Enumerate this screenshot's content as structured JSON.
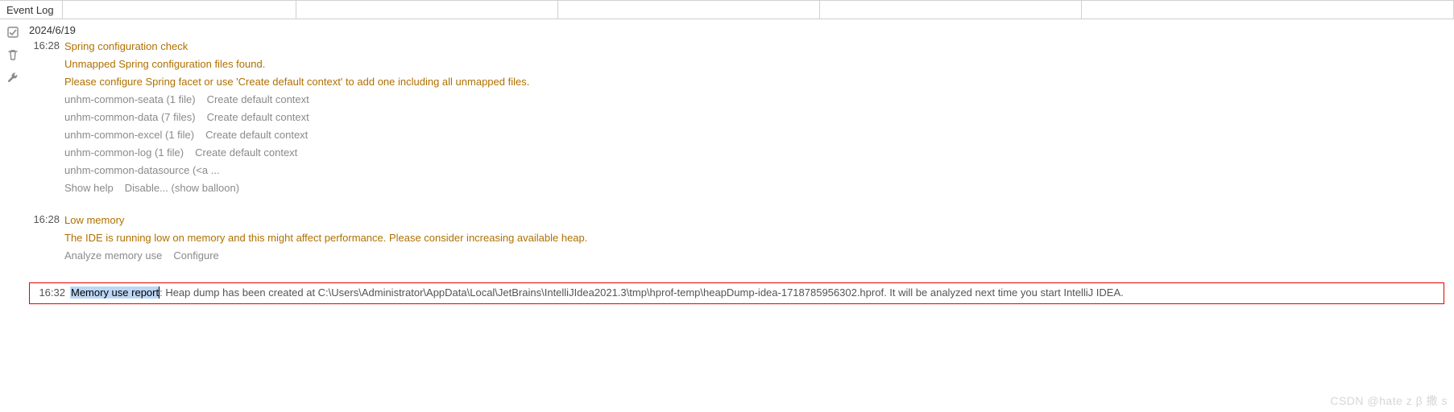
{
  "header": {
    "tab_label": "Event Log"
  },
  "log": {
    "date": "2024/6/19",
    "entries": [
      {
        "time": "16:28",
        "title": "Spring configuration check",
        "lines": [
          "Unmapped Spring configuration files found.",
          "Please configure Spring facet or use 'Create default context' to add one including all unmapped files."
        ],
        "modules": [
          {
            "name": "unhm-common-seata (1 file)",
            "action": "Create default context"
          },
          {
            "name": "unhm-common-data (7 files)",
            "action": "Create default context"
          },
          {
            "name": "unhm-common-excel (1 file)",
            "action": "Create default context"
          },
          {
            "name": "unhm-common-log (1 file)",
            "action": "Create default context"
          }
        ],
        "module_tail": "unhm-common-datasource (<a ...",
        "footer_actions": [
          "Show help",
          "Disable... (show balloon)"
        ]
      },
      {
        "time": "16:28",
        "title": "Low memory",
        "lines": [
          "The IDE is running low on memory and this might affect performance. Please consider increasing available heap."
        ],
        "footer_actions": [
          "Analyze memory use",
          "Configure"
        ]
      },
      {
        "time": "16:32",
        "selected_prefix": "Memory use report",
        "rest": ": Heap dump has been created at C:\\Users\\Administrator\\AppData\\Local\\JetBrains\\IntelliJIdea2021.3\\tmp\\hprof-temp\\heapDump-idea-1718785956302.hprof. It will be analyzed next time you start IntelliJ IDEA."
      }
    ]
  },
  "watermark": "CSDN @hate z β 撒 s"
}
